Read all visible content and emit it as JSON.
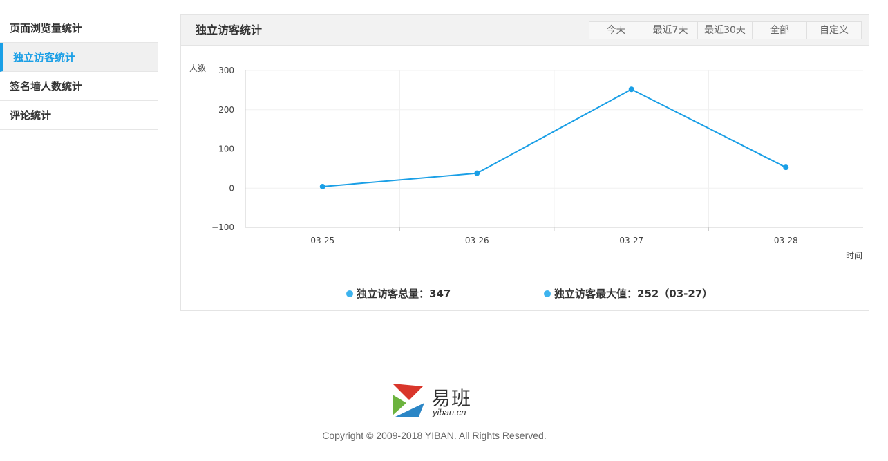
{
  "sidebar": {
    "items": [
      {
        "label": "页面浏览量统计"
      },
      {
        "label": "独立访客统计"
      },
      {
        "label": "签名墙人数统计"
      },
      {
        "label": "评论统计"
      }
    ]
  },
  "panel": {
    "title": "独立访客统计",
    "ranges": [
      "今天",
      "最近7天",
      "最近30天",
      "全部",
      "自定义"
    ]
  },
  "chart_data": {
    "type": "line",
    "categories": [
      "03-25",
      "03-26",
      "03-27",
      "03-28"
    ],
    "series": [
      {
        "values": [
          4,
          38,
          252,
          53
        ]
      }
    ],
    "ylabel": "人数",
    "xlabel": "时间",
    "ylim": [
      -100,
      300
    ],
    "yticks": [
      300,
      200,
      100,
      0,
      -100
    ],
    "line_color": "#1a9fe6",
    "grid": true
  },
  "summary": {
    "total": "独立访客总量：347",
    "max": "独立访客最大值：252（03-27）"
  },
  "footer": {
    "logo_text": "易班",
    "logo_domain": "yiban.cn",
    "copyright": "Copyright © 2009-2018 YIBAN. All Rights Reserved."
  }
}
